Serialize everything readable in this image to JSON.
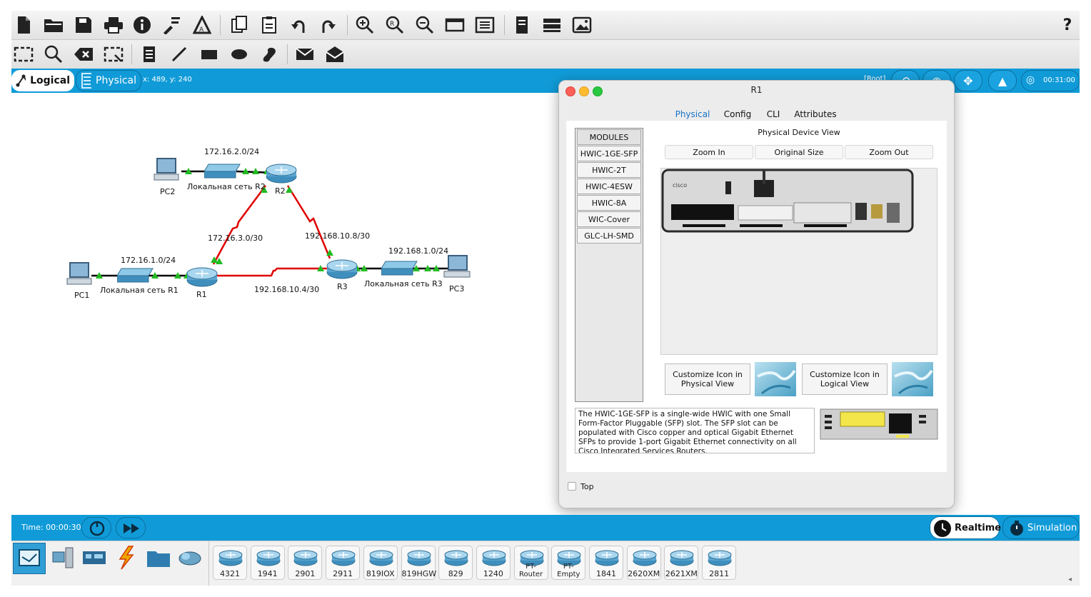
{
  "toolbar": {
    "row1_icons": [
      "new-file-icon",
      "open-folder-icon",
      "save-icon",
      "print-icon",
      "info-icon",
      "activity-wizard-icon",
      "network-info-icon",
      "copy-icon",
      "paste-icon",
      "undo-icon",
      "redo-icon",
      "zoom-in-icon",
      "zoom-reset-icon",
      "zoom-out-icon",
      "drawing-palette-icon",
      "custom-devices-icon",
      "cluster-icon",
      "pdu-list-icon",
      "screenshot-icon"
    ],
    "help_label": "?"
  },
  "workspace": {
    "logical_label": "Logical",
    "physical_label": "Physical",
    "coords": "x: 489, y: 240",
    "root_label": "[Root]",
    "clock": "00:31:00"
  },
  "topology": {
    "labels": {
      "pc1": "PC1",
      "pc2": "PC2",
      "pc3": "PC3",
      "r1": "R1",
      "r2": "R2",
      "r3": "R3",
      "lan_r1": "Локальная сеть R1",
      "lan_r2": "Локальная сеть R2",
      "lan_r3": "Локальная сеть R3",
      "net_172_16_2": "172.16.2.0/24",
      "net_172_16_1": "172.16.1.0/24",
      "net_172_16_3": "172.16.3.0/30",
      "net_192_168_10_8": "192.168.10.8/30",
      "net_192_168_10_4": "192.168.10.4/30",
      "net_192_168_1": "192.168.1.0/24"
    }
  },
  "dialog": {
    "title": "R1",
    "tabs": [
      "Physical",
      "Config",
      "CLI",
      "Attributes"
    ],
    "active_tab": "Physical",
    "physical_view_title": "Physical Device View",
    "zoom_in": "Zoom In",
    "original_size": "Original Size",
    "zoom_out": "Zoom Out",
    "modules": [
      "MODULES",
      "HWIC-1GE-SFP",
      "HWIC-2T",
      "HWIC-4ESW",
      "HWIC-8A",
      "WIC-Cover",
      "GLC-LH-SMD"
    ],
    "customize_physical": "Customize Icon in Physical View",
    "customize_logical": "Customize Icon in Logical View",
    "description": "The HWIC-1GE-SFP is a single-wide HWIC with one Small Form-Factor Pluggable (SFP) slot. The SFP slot can be populated with Cisco copper and optical Gigabit Ethernet SFPs to provide 1-port Gigabit Ethernet connectivity on all Cisco Integrated Services Routers.",
    "top_label": "Top",
    "top_checked": false,
    "brand": "cisco"
  },
  "bottom": {
    "time": "Time: 00:00:30",
    "realtime": "Realtime",
    "simulation": "Simulation",
    "mode": "Realtime",
    "devices": [
      "4321",
      "1941",
      "2901",
      "2911",
      "819IOX",
      "819HGW",
      "829",
      "1240",
      "PT-Router",
      "PT-Empty",
      "1841",
      "2620XM",
      "2621XM",
      "2811"
    ]
  },
  "colors": {
    "blue_bar": "#109bd8",
    "serial_link": "#e00000",
    "link_up": "#22bb22"
  }
}
